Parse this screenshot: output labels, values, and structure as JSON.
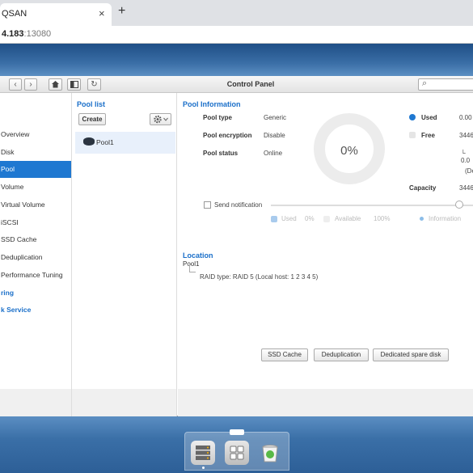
{
  "browser": {
    "tab_title": "QSAN",
    "close_glyph": "×",
    "newtab_glyph": "+",
    "url_host": "4.183",
    "url_port": ":13080"
  },
  "window": {
    "title": "Control Panel",
    "nav_back": "‹",
    "nav_forward": "›",
    "refresh": "↻",
    "search_icon": "🔍",
    "search_placeholder": ""
  },
  "sidebar": {
    "items": [
      {
        "label": "Overview"
      },
      {
        "label": "Disk"
      },
      {
        "label": "Pool",
        "active": true
      },
      {
        "label": "Volume"
      },
      {
        "label": "Virtual Volume"
      },
      {
        "label": "iSCSI"
      },
      {
        "label": "SSD Cache"
      },
      {
        "label": "Deduplication"
      },
      {
        "label": "Performance Tuning"
      },
      {
        "label": "ring",
        "section": true
      },
      {
        "label": "k Service",
        "section": true
      }
    ]
  },
  "poollist": {
    "title": "Pool list",
    "create_label": "Create",
    "gear_icon": "gear-icon",
    "pools": [
      {
        "name": "Pool1"
      }
    ]
  },
  "pool_info": {
    "title": "Pool Information",
    "rows": [
      {
        "label": "Pool type",
        "value": "Generic"
      },
      {
        "label": "Pool encryption",
        "value": "Disable"
      },
      {
        "label": "Pool status",
        "value": "Online"
      }
    ],
    "donut_percent": "0%",
    "used_label": "Used",
    "used_value": "0.00",
    "free_label": "Free",
    "free_value": "3446",
    "sub_value_1": "└ 0.0",
    "sub_value_2": "(De",
    "capacity_label": "Capacity",
    "capacity_value": "3446",
    "used_color": "#1f78d1",
    "free_color": "#e5e5e5",
    "send_notification": "Send notification",
    "legend_used": "Used",
    "legend_used_val": "0%",
    "legend_available": "Available",
    "legend_available_val": "100%",
    "legend_information": "Information"
  },
  "location": {
    "title": "Location",
    "pool": "Pool1",
    "raid": "RAID type: RAID 5 (Local host: 1 2 3 4 5)"
  },
  "actions": {
    "ssd_cache": "SSD Cache",
    "deduplication": "Deduplication",
    "dedicated_spare": "Dedicated spare disk"
  },
  "dock": {
    "items": [
      "storage-manager-icon",
      "app-grid-icon",
      "recycle-bin-icon"
    ]
  }
}
